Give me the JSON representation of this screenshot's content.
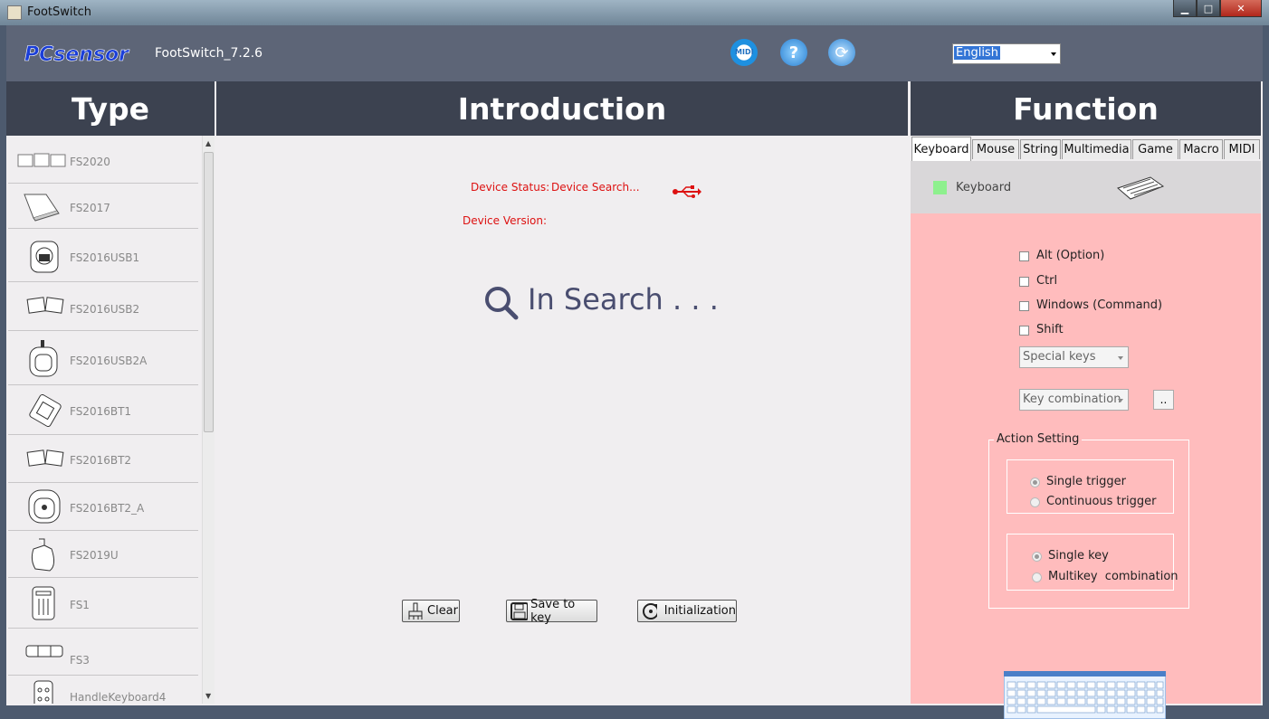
{
  "window": {
    "title": "FootSwitch",
    "minimize": "▁",
    "maximize": "□",
    "close": "✕"
  },
  "header": {
    "logo_text": "PCsensor",
    "version": "FootSwitch_7.2.6",
    "language": "English",
    "icons": [
      "midi-icon",
      "help-icon",
      "refresh-icon"
    ],
    "midi_label": "MIDI"
  },
  "columns": {
    "type": "Type",
    "introduction": "Introduction",
    "function": "Function"
  },
  "types": [
    "FS2020",
    "FS2017",
    "FS2016USB1",
    "FS2016USB2",
    "FS2016USB2A",
    "FS2016BT1",
    "FS2016BT2",
    "FS2016BT2_A",
    "FS2019U",
    "FS1",
    "FS3",
    "HandleKeyboard4"
  ],
  "intro": {
    "device_status_label": "Device Status:",
    "device_status_value": "Device Search...",
    "device_version_label": "Device Version:",
    "search_text": "In Search . . .",
    "clear": "Clear",
    "save": "Save to key",
    "init": "Initialization"
  },
  "function": {
    "tabs": [
      "Keyboard",
      "Mouse",
      "String",
      "Multimedia",
      "Game",
      "Macro",
      "MIDI"
    ],
    "active_tab": "Keyboard",
    "keyboard_label": "Keyboard",
    "modifiers": [
      "Alt (Option)",
      "Ctrl",
      "Windows (Command)",
      "Shift"
    ],
    "special_keys": "Special keys",
    "key_combination": "Key combination",
    "more_button": "..",
    "action_setting": "Action Setting",
    "trigger_options": [
      "Single trigger",
      "Continuous trigger"
    ],
    "key_options": [
      "Single key",
      "Multikey  combination"
    ]
  },
  "colors": {
    "header": "#5d6577",
    "column_header": "#3c4250",
    "function_bg": "#ffbcbd",
    "status_red": "#dd1111",
    "search_text": "#4a4e70"
  }
}
